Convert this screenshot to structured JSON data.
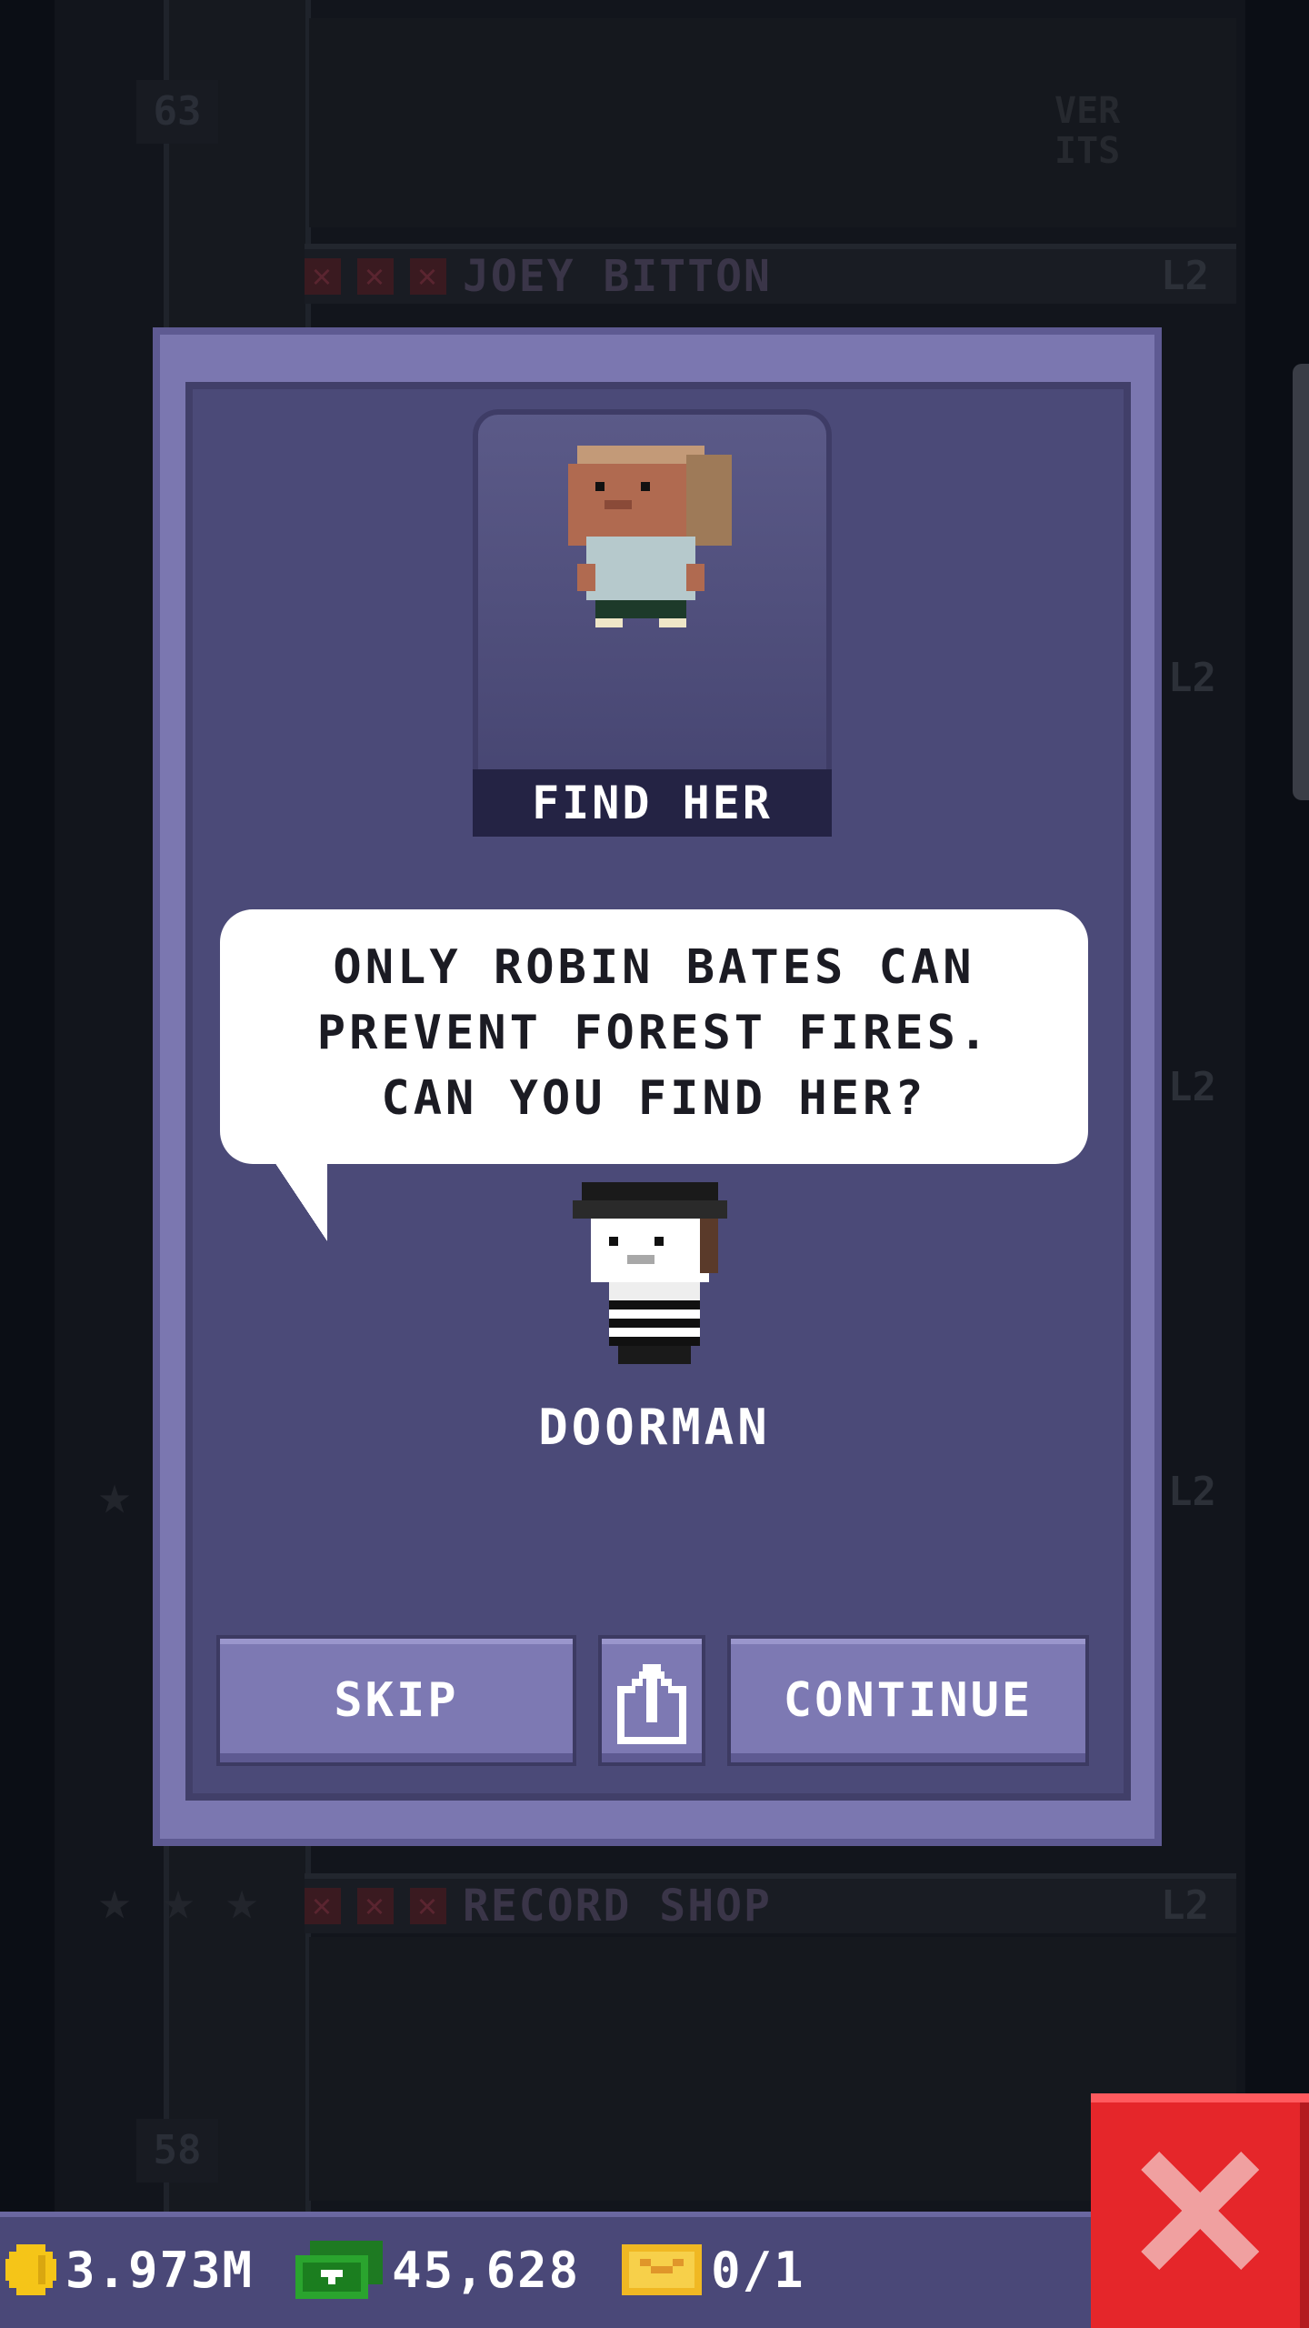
{
  "background": {
    "floors": [
      {
        "number": "63",
        "level": ""
      },
      {
        "name": "JOEY BITTON",
        "level": "L2"
      },
      {
        "name": "RECORD SHOP",
        "level": "L2"
      },
      {
        "number": "58",
        "level": ""
      }
    ],
    "side_levels": [
      "L2",
      "L2",
      "L2"
    ],
    "shop_sign_fragment": "VER\nITS"
  },
  "dialog": {
    "portrait_caption": "FIND HER",
    "speech_text": "ONLY ROBIN BATES CAN\nPREVENT FOREST FIRES.\nCAN YOU FIND HER?",
    "speaker_name": "DOORMAN",
    "buttons": {
      "skip": "SKIP",
      "continue": "CONTINUE"
    }
  },
  "status_bar": {
    "coins": "3.973M",
    "bux": "45,628",
    "tickets": "0/1"
  },
  "colors": {
    "dialog_outer": "#7b77b0",
    "dialog_inner": "#4b4a78",
    "button": "#7d79b3",
    "close_red": "#e5262a",
    "coin_gold": "#f5c518",
    "bux_green": "#2aa42e"
  },
  "icons": {
    "share": "share-icon",
    "close": "close-icon",
    "coin": "coin-icon",
    "bux": "bux-icon",
    "ticket": "ticket-icon"
  }
}
